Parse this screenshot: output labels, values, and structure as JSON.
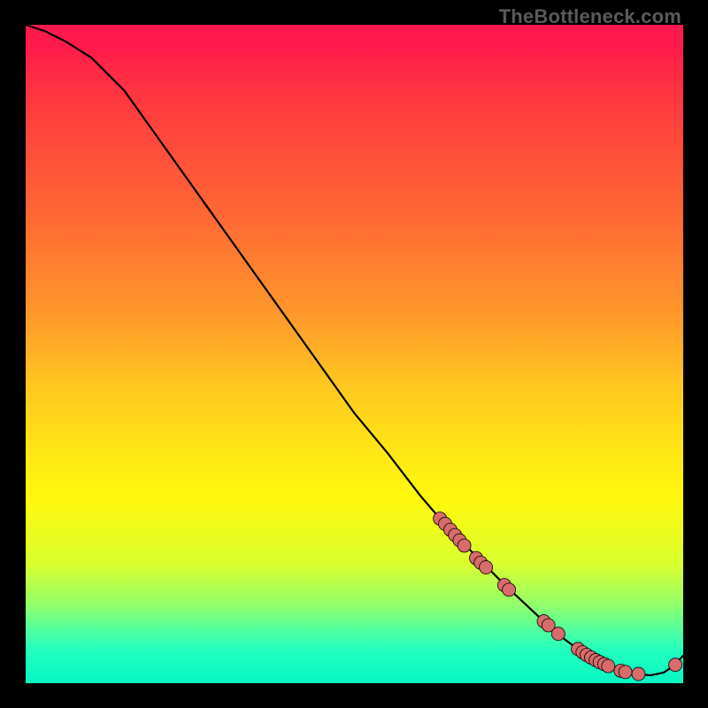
{
  "watermark": "TheBottleneck.com",
  "colors": {
    "dot_fill": "#d86b6b",
    "curve_stroke": "#000000"
  },
  "chart_data": {
    "type": "line",
    "title": "",
    "xlabel": "",
    "ylabel": "",
    "xlim": [
      0,
      100
    ],
    "ylim": [
      0,
      100
    ],
    "grid": false,
    "notes": "No axis ticks or numeric labels are visible in the image; background is a vertical color gradient from red (top) to green (bottom). Curve falls from top-left toward lower-right, flattens near the bottom, then rises slightly at the far right. Scatter points (pink dots) lie along the lower-right portion of the curve.",
    "series": [
      {
        "name": "curve",
        "kind": "line",
        "x": [
          0,
          3,
          6,
          10,
          15,
          20,
          25,
          30,
          35,
          40,
          45,
          50,
          55,
          60,
          63,
          65,
          68,
          70,
          73,
          76,
          79,
          81,
          83,
          85,
          87,
          89,
          91,
          93,
          95,
          97,
          98.5,
          100
        ],
        "y": [
          100,
          99,
          97.5,
          95,
          90,
          83,
          76,
          69,
          62,
          55,
          48,
          41,
          35,
          28.5,
          25,
          23,
          19.8,
          17.8,
          14.8,
          12,
          9.2,
          7.4,
          5.9,
          4.5,
          3.4,
          2.5,
          1.8,
          1.4,
          1.2,
          1.6,
          2.6,
          4.2
        ]
      },
      {
        "name": "dots",
        "kind": "scatter",
        "x": [
          63,
          63.8,
          64.6,
          65.3,
          66,
          66.7,
          68.5,
          69.2,
          70,
          72.8,
          73.5,
          78.8,
          79.5,
          81,
          84,
          84.7,
          85.3,
          86,
          86.7,
          87.3,
          88,
          88.6,
          90.5,
          91.2,
          93.2,
          98.8
        ],
        "y": [
          25,
          24.2,
          23.3,
          22.5,
          21.7,
          20.9,
          19,
          18.3,
          17.6,
          14.9,
          14.2,
          9.4,
          8.8,
          7.5,
          5.2,
          4.7,
          4.3,
          3.9,
          3.5,
          3.2,
          2.9,
          2.6,
          1.9,
          1.7,
          1.4,
          2.8
        ],
        "marker_radius": 7.5
      }
    ]
  }
}
